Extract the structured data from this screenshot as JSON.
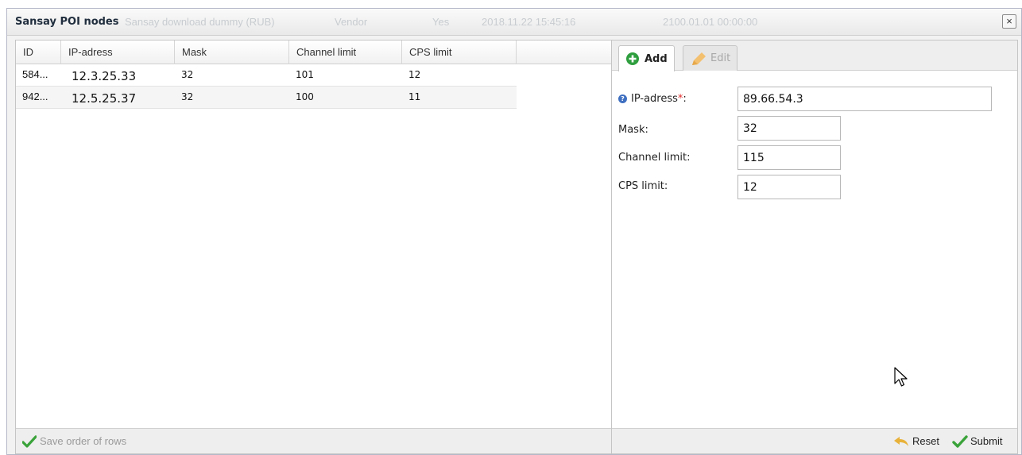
{
  "window": {
    "title": "Sansay POI nodes",
    "background_row": [
      "Sansay download dummy (RUB)",
      "Vendor",
      "Yes",
      "2018.11.22 15:45:16",
      "2100.01.01 00:00:00"
    ],
    "close_label": "×"
  },
  "grid": {
    "columns": [
      "ID",
      "IP-adress",
      "Mask",
      "Channel limit",
      "CPS limit"
    ],
    "rows": [
      {
        "id": "584...",
        "ip": "12.3.25.33",
        "mask": "32",
        "channel_limit": "101",
        "cps_limit": "12"
      },
      {
        "id": "942...",
        "ip": "12.5.25.37",
        "mask": "32",
        "channel_limit": "100",
        "cps_limit": "11"
      }
    ],
    "save_order_label": "Save order of rows"
  },
  "form": {
    "tabs": {
      "add": "Add",
      "edit": "Edit"
    },
    "fields": {
      "ip": {
        "label": "IP-adress",
        "required_mark": "*",
        "colon": ":",
        "value": "89.66.54.3"
      },
      "mask": {
        "label": "Mask:",
        "value": "32"
      },
      "channel_limit": {
        "label": "Channel limit:",
        "value": "115"
      },
      "cps_limit": {
        "label": "CPS limit:",
        "value": "12"
      }
    },
    "reset_label": "Reset",
    "submit_label": "Submit"
  },
  "colors": {
    "add_icon": "#2e9e3e",
    "check": "#3aa33a",
    "reset_arrow": "#e8b23a",
    "help": "#3f6fc0"
  },
  "icons": [
    "close-icon",
    "add-icon",
    "pencil-icon",
    "check-icon",
    "reset-arrow-icon",
    "help-icon",
    "mouse-cursor-icon"
  ]
}
